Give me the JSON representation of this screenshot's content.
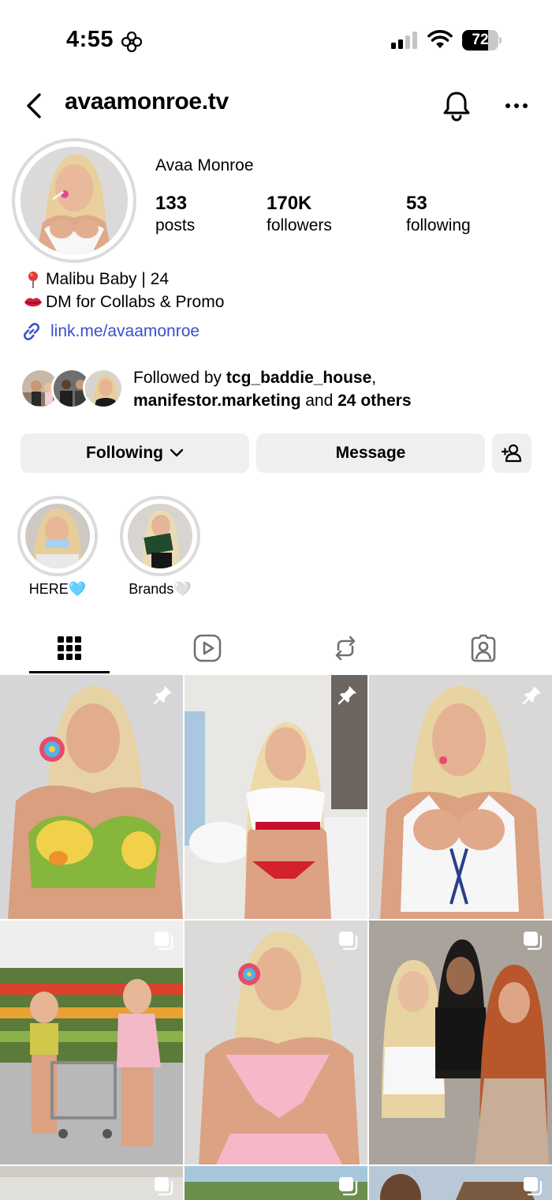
{
  "status_bar": {
    "time": "4:55",
    "battery_level": "72",
    "battery_fraction": 0.72
  },
  "header": {
    "username": "avaamonroe.tv",
    "icons": [
      "back-icon",
      "bell-icon",
      "more-icon"
    ]
  },
  "profile": {
    "display_name": "Avaa Monroe",
    "stats": [
      {
        "value": "133",
        "label": "posts"
      },
      {
        "value": "170K",
        "label": "followers"
      },
      {
        "value": "53",
        "label": "following"
      }
    ],
    "bio": [
      {
        "icon": "pin-icon",
        "text": "Malibu Baby | 24"
      },
      {
        "icon": "lips-icon",
        "text": "DM for Collabs & Promo"
      }
    ],
    "link": "link.me/avaamonroe",
    "followed_by": {
      "prefix": "Followed by ",
      "user1": "tcg_baddie_house",
      "sep": ",",
      "user2": "manifestor.marketing",
      "middle": " and ",
      "others": "24 others"
    }
  },
  "actions": {
    "following_label": "Following",
    "message_label": "Message",
    "add_user_icon": "add-person-icon"
  },
  "highlights": [
    {
      "label": "HERE🩵"
    },
    {
      "label": "Brands🤍"
    }
  ],
  "tabs": [
    "grid-icon",
    "reels-icon",
    "reposts-icon",
    "tagged-icon"
  ],
  "grid": {
    "badges": [
      "pin-icon",
      "pin-icon",
      "pin-icon",
      "carousel-icon",
      "carousel-icon",
      "carousel-icon",
      "carousel-icon",
      "carousel-icon",
      "carousel-icon"
    ]
  },
  "colors": {
    "link": "#3a4fce",
    "button_bg": "#efefef",
    "ring": "#dbdbdb"
  }
}
